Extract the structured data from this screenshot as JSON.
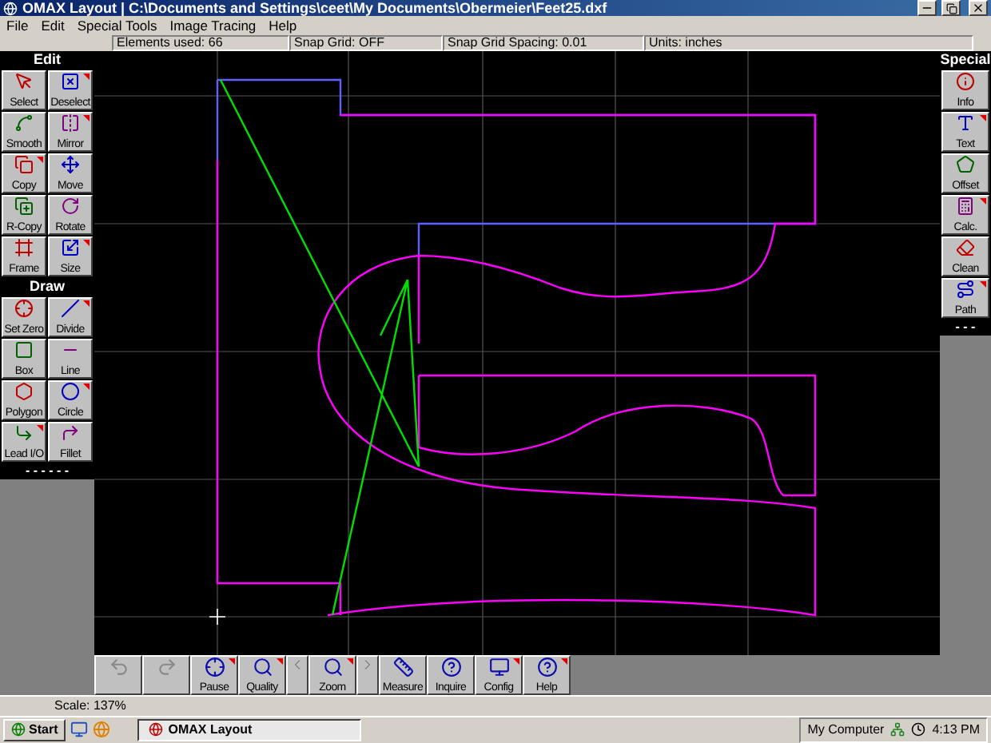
{
  "window": {
    "title": "OMAX Layout | C:\\Documents and Settings\\ceet\\My Documents\\Obermeier\\Feet25.dxf"
  },
  "menu": [
    "File",
    "Edit",
    "Special Tools",
    "Image Tracing",
    "Help"
  ],
  "status_bar": [
    "Elements used: 66",
    "Snap Grid: OFF",
    "Snap Grid Spacing: 0.01",
    "Units: inches"
  ],
  "left_palette": [
    {
      "title": "Edit",
      "buttons": [
        {
          "label": "Select",
          "flag": false
        },
        {
          "label": "Deselect",
          "flag": true
        },
        {
          "label": "Smooth",
          "flag": false
        },
        {
          "label": "Mirror",
          "flag": true
        },
        {
          "label": "Copy",
          "flag": true
        },
        {
          "label": "Move",
          "flag": false
        },
        {
          "label": "R-Copy",
          "flag": false
        },
        {
          "label": "Rotate",
          "flag": false
        },
        {
          "label": "Frame",
          "flag": false
        },
        {
          "label": "Size",
          "flag": true
        }
      ]
    },
    {
      "title": "Draw",
      "buttons": [
        {
          "label": "Set Zero",
          "flag": false
        },
        {
          "label": "Divide",
          "flag": true
        },
        {
          "label": "Box",
          "flag": false
        },
        {
          "label": "Line",
          "flag": false
        },
        {
          "label": "Polygon",
          "flag": false
        },
        {
          "label": "Circle",
          "flag": true
        },
        {
          "label": "Lead I/O",
          "flag": true
        },
        {
          "label": "Fillet",
          "flag": false
        }
      ]
    }
  ],
  "left_more": "- - - - - -",
  "right_palette": {
    "title": "Special",
    "buttons": [
      {
        "label": "Info",
        "flag": false
      },
      {
        "label": "Text",
        "flag": true
      },
      {
        "label": "Offset",
        "flag": false
      },
      {
        "label": "Calc.",
        "flag": true
      },
      {
        "label": "Clean",
        "flag": false
      },
      {
        "label": "Path",
        "flag": true
      }
    ]
  },
  "right_more": "- - -",
  "bottom_toolbar": [
    {
      "kind": "tool",
      "disabled": true,
      "flag": false
    },
    {
      "kind": "tool",
      "disabled": true,
      "flag": false
    },
    {
      "kind": "tool",
      "label": "Pause",
      "disabled": false,
      "flag": true
    },
    {
      "kind": "tool",
      "label": "Quality",
      "disabled": false,
      "flag": true
    },
    {
      "kind": "nav",
      "disabled": true
    },
    {
      "kind": "tool",
      "label": "Zoom",
      "disabled": false,
      "flag": true
    },
    {
      "kind": "nav",
      "disabled": true
    },
    {
      "kind": "tool",
      "label": "Measure",
      "disabled": false,
      "flag": false
    },
    {
      "kind": "tool",
      "label": "Inquire",
      "disabled": false,
      "flag": false
    },
    {
      "kind": "tool",
      "label": "Config",
      "disabled": false,
      "flag": true
    },
    {
      "kind": "tool",
      "label": "Help",
      "disabled": false,
      "flag": true
    }
  ],
  "scale": "Scale: 137%",
  "taskbar": {
    "start": "Start",
    "task": "OMAX Layout",
    "tray_label": "My Computer",
    "clock": "4:13 PM"
  }
}
